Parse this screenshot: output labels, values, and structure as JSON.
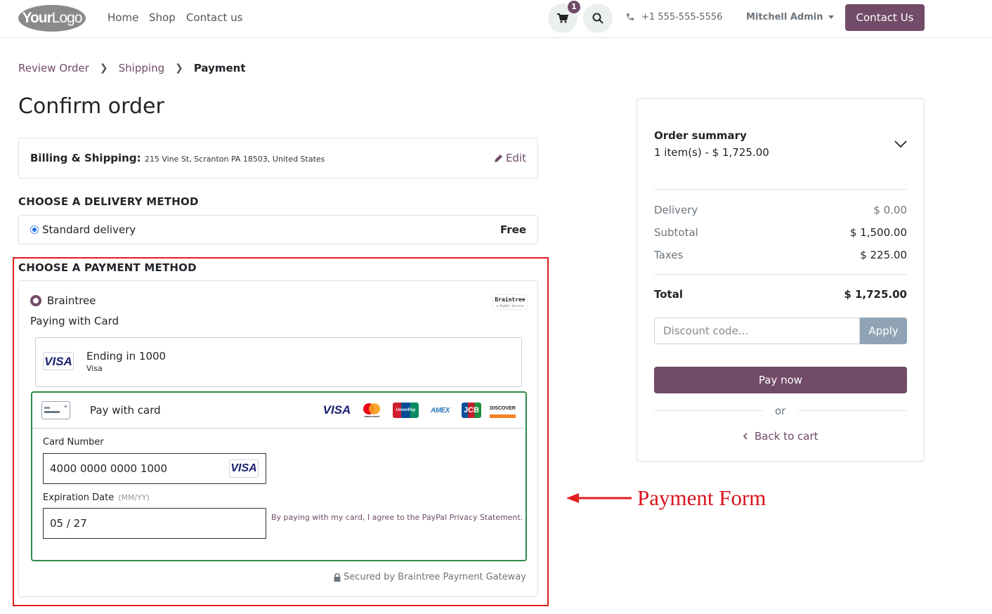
{
  "header": {
    "logo": {
      "bold": "Your",
      "light": "Logo"
    },
    "nav": [
      "Home",
      "Shop",
      "Contact us"
    ],
    "cart_count": "1",
    "phone": "+1 555-555-5556",
    "user": "Mitchell Admin",
    "contact_button": "Contact Us"
  },
  "breadcrumb": {
    "step1": "Review Order",
    "step2": "Shipping",
    "step3": "Payment"
  },
  "page_title": "Confirm order",
  "billing": {
    "label": "Billing & Shipping:",
    "address": "215 Vine St, Scranton PA 18503, United States",
    "edit": "Edit"
  },
  "delivery": {
    "section_title": "CHOOSE A DELIVERY METHOD",
    "name": "Standard delivery",
    "price": "Free"
  },
  "payment": {
    "section_title": "CHOOSE A PAYMENT METHOD",
    "provider": "Braintree",
    "provider_logo": "Braintree",
    "provider_logo_sub": "a PayPal Service",
    "paying_with": "Paying with Card",
    "saved_card": {
      "brand": "VISA",
      "title": "Ending in 1000",
      "subtitle": "Visa"
    },
    "form": {
      "title": "Pay with card",
      "brands": [
        "VISA",
        "mastercard",
        "UnionPay",
        "AMEX",
        "JCB",
        "DISCOVER"
      ],
      "card_number_label": "Card Number",
      "card_number": "4000 0000 0000 1000",
      "card_brand": "VISA",
      "expiry_label": "Expiration Date",
      "expiry_hint": "(MM/YY)",
      "expiry": "05 / 27",
      "consent": "By paying with my card, I agree to the PayPal Privacy Statement."
    },
    "secured": "Secured by Braintree Payment Gateway"
  },
  "annotation": {
    "text": "Payment Form",
    "color": "#d9131e"
  },
  "summary": {
    "title": "Order summary",
    "items": "1 item(s) -  $ 1,725.00",
    "delivery_label": "Delivery",
    "delivery_value": "$ 0.00",
    "subtotal_label": "Subtotal",
    "subtotal_value": "$ 1,500.00",
    "taxes_label": "Taxes",
    "taxes_value": "$ 225.00",
    "total_label": "Total",
    "total_value": "$ 1,725.00",
    "discount_placeholder": "Discount code...",
    "apply": "Apply",
    "pay_now": "Pay now",
    "or": "or",
    "back": "Back to cart"
  },
  "colors": {
    "brand": "#714b67",
    "success_border": "#2e8b47",
    "annotation": "#e01e1e"
  }
}
